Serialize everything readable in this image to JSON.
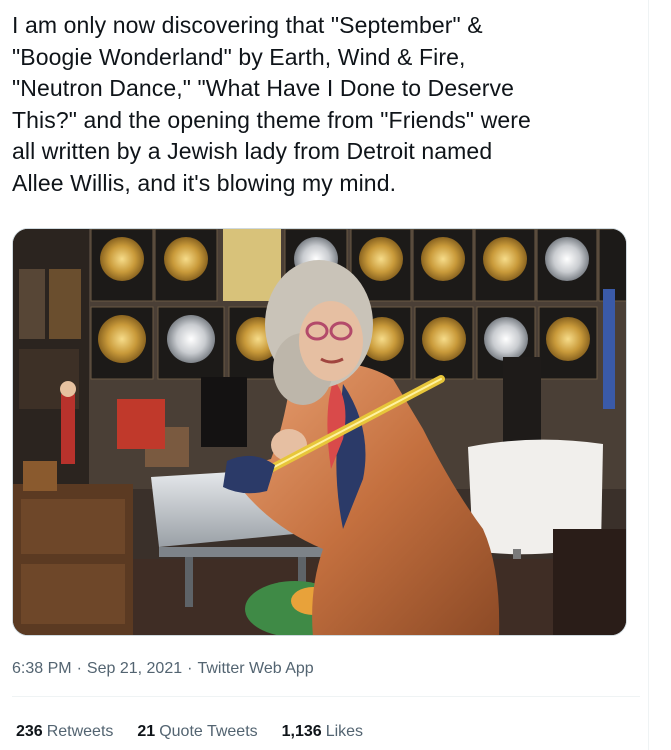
{
  "tweet": {
    "text": "I am only now discovering that \"September\" &\n\"Boogie Wonderland\" by Earth, Wind & Fire,\n\"Neutron Dance,\" \"What Have I Done to Deserve\nThis?\" and the opening theme from \"Friends\" were\nall written by a Jewish lady from Detroit named\nAllee Willis, and it's blowing my mind.",
    "time": "6:38 PM",
    "date": "Sep 21, 2021",
    "source": "Twitter Web App",
    "separator": "·"
  },
  "stats": {
    "retweets_count": "236",
    "retweets_label": "Retweets",
    "quotes_count": "21",
    "quotes_label": "Quote Tweets",
    "likes_count": "1,136",
    "likes_label": "Likes"
  },
  "colors": {
    "text": "#0f1419",
    "secondary": "#536471",
    "border": "#eff3f4"
  }
}
